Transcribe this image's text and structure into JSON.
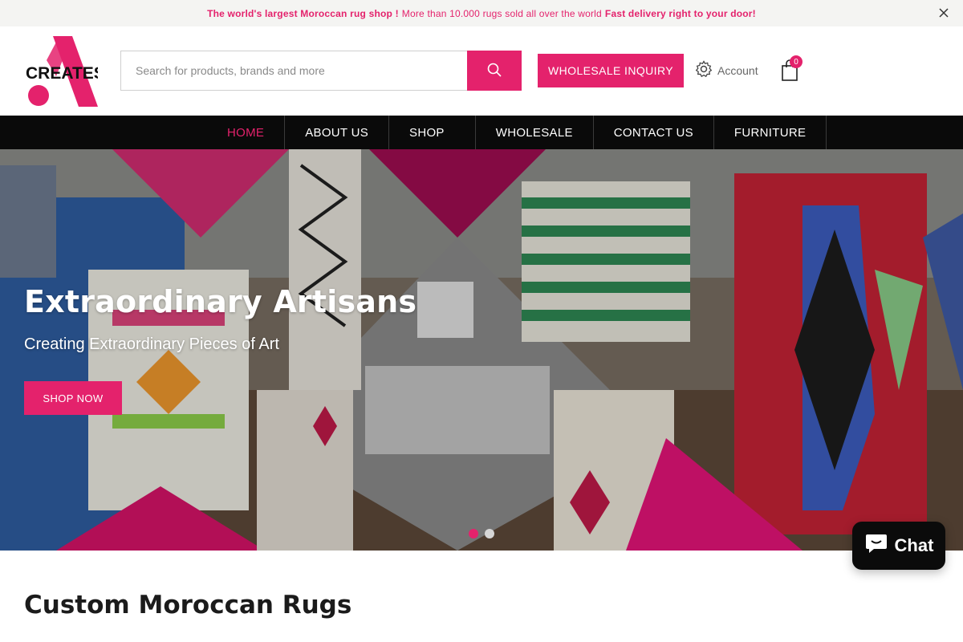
{
  "announcement": {
    "lead": "The world's largest Moroccan rug shop !",
    "middle": "More than 10.000 rugs sold all over the world",
    "tail": "Fast delivery right to your door!",
    "close_icon": "close-icon"
  },
  "header": {
    "logo_text": "CREATES",
    "search_placeholder": "Search for products, brands and more",
    "search_value": "",
    "search_icon": "search-icon",
    "wholesale_label": "WHOLESALE INQUIRY",
    "account_label": "Account",
    "account_icon": "gear-icon",
    "cart_icon": "shopping-bag-icon",
    "cart_count": "0"
  },
  "nav": {
    "items": [
      {
        "label": "HOME",
        "active": true
      },
      {
        "label": "ABOUT US",
        "active": false
      },
      {
        "label": "SHOP",
        "active": false
      },
      {
        "label": "WHOLESALE",
        "active": false
      },
      {
        "label": "CONTACT US",
        "active": false
      },
      {
        "label": "FURNITURE",
        "active": false
      }
    ]
  },
  "hero": {
    "title": "Extraordinary Artisans",
    "subtitle": "Creating Extraordinary Pieces of Art",
    "cta": "SHOP NOW",
    "slide_count": 2,
    "active_slide": 1
  },
  "main": {
    "section_title": "Custom Moroccan Rugs"
  },
  "chat": {
    "label": "Chat",
    "icon": "chat-bubble-icon"
  },
  "colors": {
    "accent": "#e4226c",
    "nav_bg": "#0a0a0a",
    "announce_bg": "#f4f4f2"
  }
}
